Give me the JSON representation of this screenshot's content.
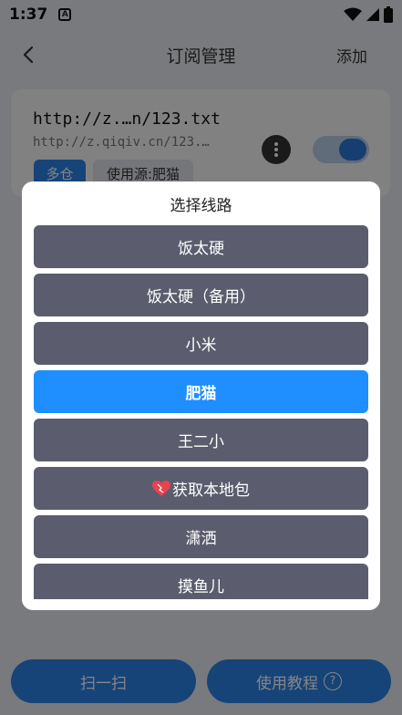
{
  "status_bar": {
    "time": "1:37",
    "notification_glyph": "A"
  },
  "app_bar": {
    "title": "订阅管理",
    "add_label": "添加"
  },
  "subscription": {
    "title": "http://z.…n/123.txt",
    "url": "http://z.qiqiv.cn/123.…",
    "tag_multi": "多仓",
    "tag_source": "使用源:肥猫",
    "enabled": true
  },
  "bottom": {
    "scan_label": "扫一扫",
    "tutorial_label": "使用教程",
    "help_glyph": "?"
  },
  "dialog": {
    "title": "选择线路",
    "routes": [
      {
        "label": "饭太硬"
      },
      {
        "label": "饭太硬（备用）"
      },
      {
        "label": "小米"
      },
      {
        "label": "肥猫",
        "selected": true
      },
      {
        "label": "王二小"
      },
      {
        "label": "获取本地包",
        "icon": "heart-icon"
      },
      {
        "label": "潇洒"
      },
      {
        "label": "摸鱼儿"
      }
    ]
  },
  "colors": {
    "accent": "#1f8eff",
    "route_bg": "#5b5d6e",
    "primary_button": "#2b82e6"
  }
}
